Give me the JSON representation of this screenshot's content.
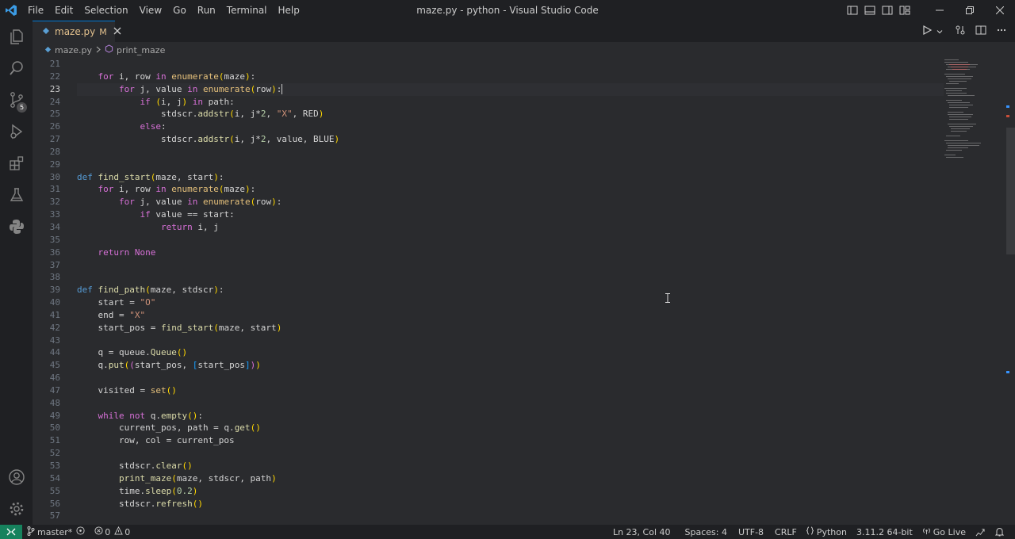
{
  "window": {
    "title": "maze.py - python - Visual Studio Code",
    "menu": [
      "File",
      "Edit",
      "Selection",
      "View",
      "Go",
      "Run",
      "Terminal",
      "Help"
    ]
  },
  "activity_bar": {
    "source_control_badge": "5",
    "icons": [
      "explorer-icon",
      "search-icon",
      "source-control-icon",
      "run-debug-icon",
      "extensions-icon",
      "testing-icon",
      "python-icon",
      "accounts-icon",
      "manage-gear-icon"
    ]
  },
  "tab": {
    "filename": "maze.py",
    "modified": "M"
  },
  "breadcrumb": {
    "file": "maze.py",
    "symbol": "print_maze"
  },
  "editor": {
    "active_line": 23,
    "line_numbers": [
      "21",
      "22",
      "23",
      "24",
      "25",
      "26",
      "27",
      "28",
      "29",
      "30",
      "31",
      "32",
      "33",
      "34",
      "35",
      "36",
      "37",
      "38",
      "39",
      "40",
      "41",
      "42",
      "43",
      "44",
      "45",
      "46",
      "47",
      "48",
      "49",
      "50",
      "51",
      "52",
      "53",
      "54",
      "55",
      "56",
      "57"
    ],
    "code_lines": [
      "",
      "    for i, row in enumerate(maze):",
      "        for j, value in enumerate(row):",
      "            if (i, j) in path:",
      "                stdscr.addstr(i, j*2, \"X\", RED)",
      "            else:",
      "                stdscr.addstr(i, j*2, value, BLUE)",
      "",
      "",
      "def find_start(maze, start):",
      "    for i, row in enumerate(maze):",
      "        for j, value in enumerate(row):",
      "            if value == start:",
      "                return i, j",
      "",
      "    return None",
      "",
      "",
      "def find_path(maze, stdscr):",
      "    start = \"O\"",
      "    end = \"X\"",
      "    start_pos = find_start(maze, start)",
      "",
      "    q = queue.Queue()",
      "    q.put((start_pos, [start_pos]))",
      "",
      "    visited = set()",
      "",
      "    while not q.empty():",
      "        current_pos, path = q.get()",
      "        row, col = current_pos",
      "",
      "        stdscr.clear()",
      "        print_maze(maze, stdscr, path)",
      "        time.sleep(0.2)",
      "        stdscr.refresh()",
      ""
    ]
  },
  "status_bar": {
    "branch": "master*",
    "errors": "0",
    "warnings": "0",
    "cursor": "Ln 23, Col 40",
    "indent": "Spaces: 4",
    "encoding": "UTF-8",
    "eol": "CRLF",
    "language": "Python",
    "interpreter": "3.11.2 64-bit",
    "go_live": "Go Live"
  }
}
